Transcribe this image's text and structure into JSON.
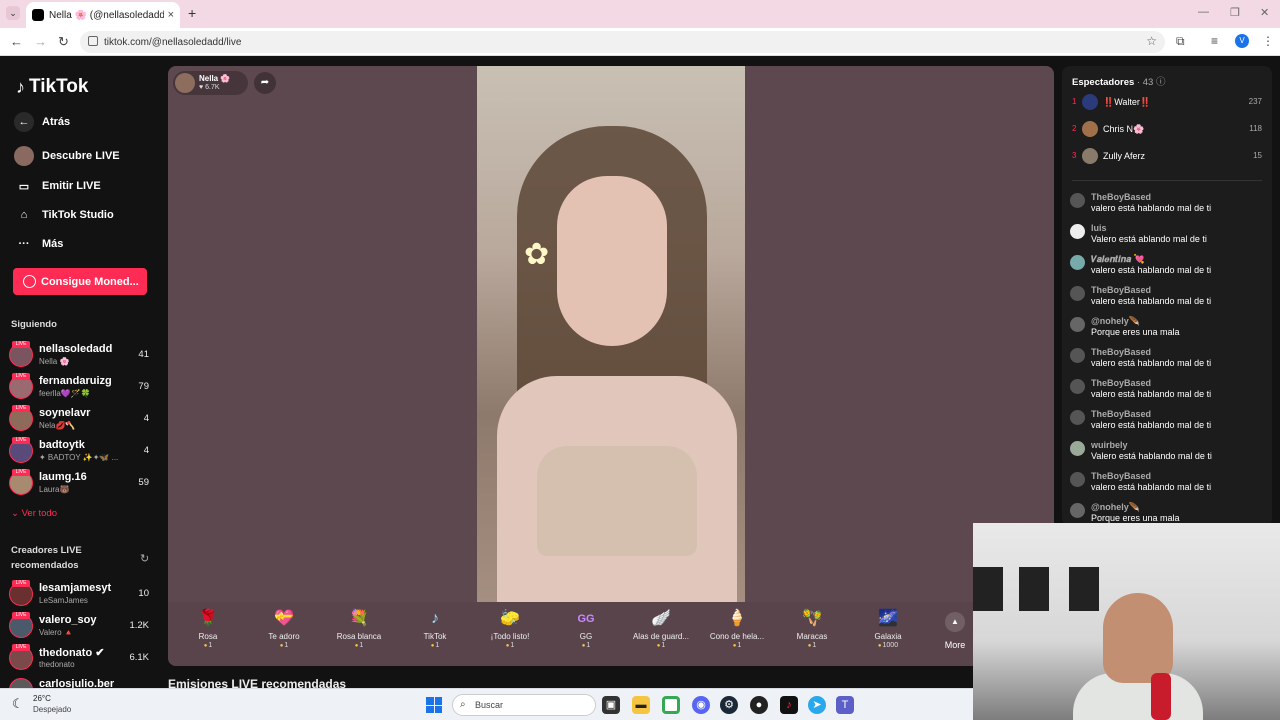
{
  "browser": {
    "tab_title": "Nella 🌸 (@nellasoledadd) ...",
    "url": "tiktok.com/@nellasoledadd/live",
    "profile_initial": "V"
  },
  "sidebar": {
    "logo": "TikTok",
    "nav": [
      {
        "label": "Atrás",
        "icon": "back-arrow-icon"
      },
      {
        "label": "Descubre LIVE",
        "icon": "live-avatar-icon"
      },
      {
        "label": "Emitir LIVE",
        "icon": "camera-icon"
      },
      {
        "label": "TikTok Studio",
        "icon": "studio-icon"
      },
      {
        "label": "Más",
        "icon": "more-dots-icon"
      }
    ],
    "coins_button": "Consigue Moned...",
    "following_title": "Siguiendo",
    "following": [
      {
        "name": "nellasoledadd",
        "sub": "Nella 🌸",
        "count": "41"
      },
      {
        "name": "fernandaruizg",
        "sub": "feerlla💜🪄🍀",
        "count": "79"
      },
      {
        "name": "soynelavr",
        "sub": "Nela💋🪓",
        "count": "4"
      },
      {
        "name": "badtoytk",
        "sub": "✦ BADTOY ✨✦🦋 ...",
        "count": "4"
      },
      {
        "name": "laumg.16",
        "sub": "Laura🐻",
        "count": "59"
      }
    ],
    "see_all": "Ver todo",
    "recommended_title": "Creadores LIVE recomendados",
    "recommended": [
      {
        "name": "lesamjamesyt",
        "sub": "LeSamJames",
        "count": "10"
      },
      {
        "name": "valero_soy",
        "sub": "Valero 🔺",
        "count": "1.2K"
      },
      {
        "name": "thedonato ✔",
        "sub": "thedonato",
        "count": "6.1K"
      },
      {
        "name": "carlosjulio.ber",
        "sub": "",
        "count": ""
      }
    ]
  },
  "live": {
    "host_name": "Nella 🌸",
    "host_likes": "♥ 6.7K",
    "gifts": [
      {
        "name": "Rosa",
        "price": "1",
        "icon": "🌹"
      },
      {
        "name": "Te adoro",
        "price": "1",
        "icon": "💝"
      },
      {
        "name": "Rosa blanca",
        "price": "1",
        "icon": "💐"
      },
      {
        "name": "TikTok",
        "price": "1",
        "icon": "♪"
      },
      {
        "name": "¡Todo listo!",
        "price": "1",
        "icon": "🧽"
      },
      {
        "name": "GG",
        "price": "1",
        "icon": "GG"
      },
      {
        "name": "Alas de guard...",
        "price": "1",
        "icon": "🪽"
      },
      {
        "name": "Cono de hela...",
        "price": "1",
        "icon": "🍦"
      },
      {
        "name": "Maracas",
        "price": "1",
        "icon": "🪇"
      },
      {
        "name": "Galaxia",
        "price": "1000",
        "icon": "🌌"
      }
    ],
    "more_label": "More",
    "recommended_streams": "Emisiones LIVE recomendadas"
  },
  "viewers": {
    "title": "Espectadores",
    "count": "· 43",
    "top": [
      {
        "rank": "1",
        "name": "‼️Walter‼️",
        "score": "237"
      },
      {
        "rank": "2",
        "name": "Chris N🌸",
        "score": "118"
      },
      {
        "rank": "3",
        "name": "Zully Aferz",
        "score": "15"
      }
    ]
  },
  "chat": [
    {
      "user": "TheBoyBased",
      "msg": "valero está hablando mal de ti"
    },
    {
      "user": "luis",
      "msg": "Valero está ablando mal de ti"
    },
    {
      "user": "𝑽𝒂𝒍𝒆𝒏𝒕𝒊𝒏𝒂 💘",
      "msg": "valero está hablando mal de ti"
    },
    {
      "user": "TheBoyBased",
      "msg": "valero está hablando mal de ti"
    },
    {
      "user": "@nohely🪶",
      "msg": "Porque eres una mala"
    },
    {
      "user": "TheBoyBased",
      "msg": "valero está hablando mal de ti"
    },
    {
      "user": "TheBoyBased",
      "msg": "valero está hablando mal de ti"
    },
    {
      "user": "TheBoyBased",
      "msg": "valero está hablando mal de ti"
    },
    {
      "user": "wuirbely",
      "msg": "Valero está hablando mal de ti"
    },
    {
      "user": "TheBoyBased",
      "msg": "valero está hablando mal de ti"
    },
    {
      "user": "@nohely🪶",
      "msg": "Porque eres una mala"
    }
  ],
  "taskbar": {
    "temp": "26°C",
    "condition": "Despejado",
    "search_placeholder": "Buscar"
  }
}
